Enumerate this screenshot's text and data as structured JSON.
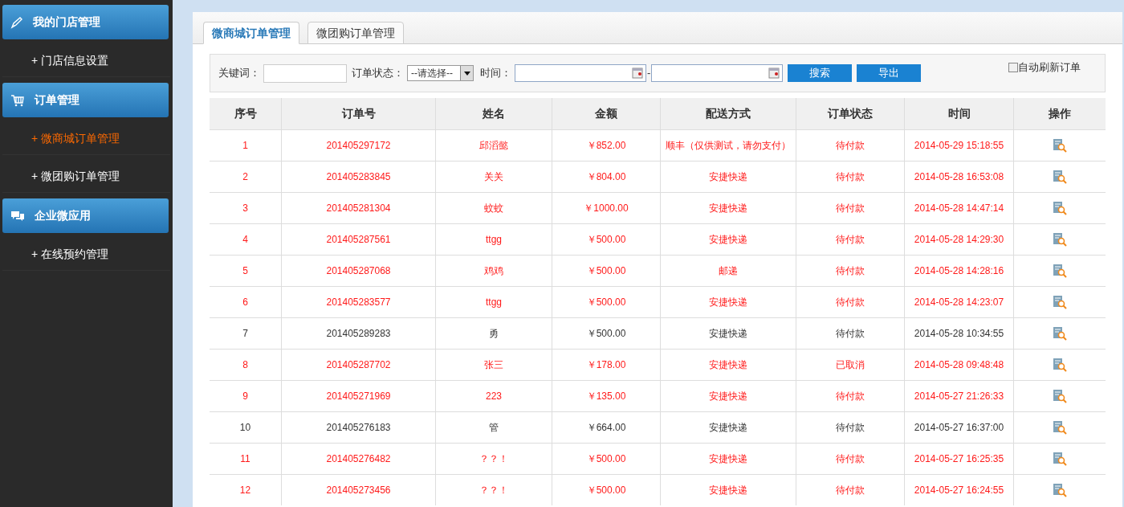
{
  "sidebar": {
    "groups": [
      {
        "title": "我的门店管理",
        "items": [
          {
            "label": "+ 门店信息设置",
            "selected": false
          }
        ]
      },
      {
        "title": "订单管理",
        "items": [
          {
            "label": "+ 微商城订单管理",
            "selected": true
          },
          {
            "label": "+ 微团购订单管理",
            "selected": false
          }
        ]
      },
      {
        "title": "企业微应用",
        "items": [
          {
            "label": "+ 在线预约管理",
            "selected": false
          }
        ]
      }
    ]
  },
  "tabs": [
    {
      "label": "微商城订单管理",
      "selected": true
    },
    {
      "label": "微团购订单管理",
      "selected": false
    }
  ],
  "filters": {
    "keyword_label": "关键词：",
    "status_label": "订单状态：",
    "status_value": "--请选择--",
    "time_label": "时间：",
    "time_separator": "-",
    "search_button": "搜索",
    "export_button": "导出",
    "auto_refresh": {
      "label": "自动刷新订单",
      "checked": false
    }
  },
  "table": {
    "columns": [
      "序号",
      "订单号",
      "姓名",
      "金额",
      "配送方式",
      "订单状态",
      "时间",
      "操作"
    ],
    "rows": [
      {
        "highlighted": true,
        "cells": [
          "1",
          "201405297172",
          "邱滔懿",
          "￥852.00",
          "顺丰（仅供测试，请勿支付）",
          "待付款",
          "2014-05-29 15:18:55"
        ]
      },
      {
        "highlighted": true,
        "cells": [
          "2",
          "201405283845",
          "关关",
          "￥804.00",
          "安捷快递",
          "待付款",
          "2014-05-28 16:53:08"
        ]
      },
      {
        "highlighted": true,
        "cells": [
          "3",
          "201405281304",
          "蚊蚊",
          "￥1000.00",
          "安捷快递",
          "待付款",
          "2014-05-28 14:47:14"
        ]
      },
      {
        "highlighted": true,
        "cells": [
          "4",
          "201405287561",
          "ttgg",
          "￥500.00",
          "安捷快递",
          "待付款",
          "2014-05-28 14:29:30"
        ]
      },
      {
        "highlighted": true,
        "cells": [
          "5",
          "201405287068",
          "鸡鸡",
          "￥500.00",
          "邮递",
          "待付款",
          "2014-05-28 14:28:16"
        ]
      },
      {
        "highlighted": true,
        "cells": [
          "6",
          "201405283577",
          "ttgg",
          "￥500.00",
          "安捷快递",
          "待付款",
          "2014-05-28 14:23:07"
        ]
      },
      {
        "highlighted": false,
        "cells": [
          "7",
          "201405289283",
          "勇",
          "￥500.00",
          "安捷快递",
          "待付款",
          "2014-05-28 10:34:55"
        ]
      },
      {
        "highlighted": true,
        "cells": [
          "8",
          "201405287702",
          "张三",
          "￥178.00",
          "安捷快递",
          "已取消",
          "2014-05-28 09:48:48"
        ]
      },
      {
        "highlighted": true,
        "cells": [
          "9",
          "201405271969",
          "223",
          "￥135.00",
          "安捷快递",
          "待付款",
          "2014-05-27 21:26:33"
        ]
      },
      {
        "highlighted": false,
        "cells": [
          "10",
          "201405276183",
          "管",
          "￥664.00",
          "安捷快递",
          "待付款",
          "2014-05-27 16:37:00"
        ]
      },
      {
        "highlighted": true,
        "cells": [
          "11",
          "201405276482",
          "？？！",
          "￥500.00",
          "安捷快递",
          "待付款",
          "2014-05-27 16:25:35"
        ]
      },
      {
        "highlighted": true,
        "cells": [
          "12",
          "201405273456",
          "？？！",
          "￥500.00",
          "安捷快递",
          "待付款",
          "2014-05-27 16:24:55"
        ]
      }
    ]
  }
}
